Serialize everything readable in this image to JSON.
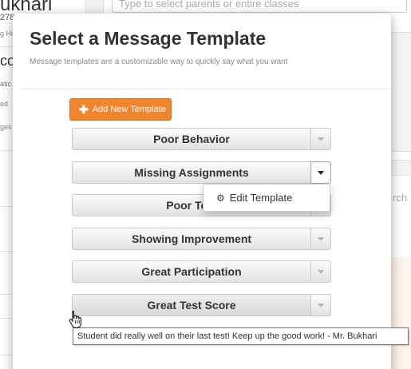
{
  "background": {
    "name_fragment": "ukhari",
    "number_fragment": "2783",
    "sub_fragment": "g Hi",
    "section_fragment": "co",
    "label_fragment_1": "atic",
    "label_fragment_2": "ed",
    "label_fragment_3": "ges",
    "search_placeholder": "Type to select parents or entire classes",
    "search_fragment": "rch"
  },
  "modal": {
    "title": "Select a Message Template",
    "subtitle": "Message templates are a customizable way to quickly say what you want",
    "add_button_label": "Add New Template",
    "add_icon": "plus-icon",
    "templates": [
      {
        "label": "Poor Behavior"
      },
      {
        "label": "Missing Assignments"
      },
      {
        "label": "Poor Test"
      },
      {
        "label": "Showing Improvement"
      },
      {
        "label": "Great Participation"
      },
      {
        "label": "Great Test Score"
      }
    ],
    "dropdown": {
      "icon": "gear-icon",
      "edit_label": "Edit Template"
    }
  },
  "tooltip": {
    "text": "Student did really well on their last test! Keep up the good work! - Mr. Bukhari"
  },
  "colors": {
    "accent": "#f0852d",
    "title_text": "#333333",
    "subtitle_text": "#888888"
  }
}
